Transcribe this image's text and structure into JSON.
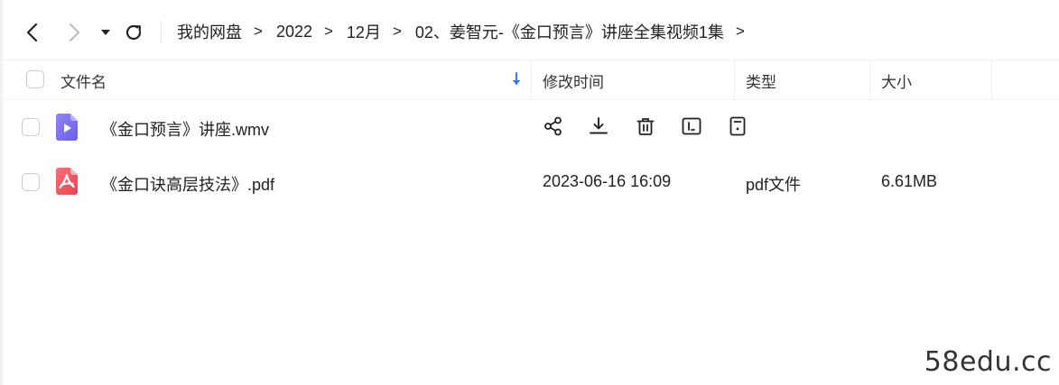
{
  "toolbar": {
    "back_icon": "chevron-left-icon",
    "forward_icon": "chevron-right-icon",
    "dropdown_icon": "caret-down-icon",
    "refresh_icon": "refresh-icon"
  },
  "breadcrumb": {
    "items": [
      "我的网盘",
      "2022",
      "12月",
      "02、姜智元-《金口预言》讲座全集视频1集"
    ],
    "separator": ">"
  },
  "table": {
    "columns": {
      "name": "文件名",
      "modified": "修改时间",
      "type": "类型",
      "size": "大小"
    },
    "rows": [
      {
        "name": "《金口预言》讲座.wmv",
        "icon": "video-file-icon",
        "modified": "",
        "type": "",
        "size": "",
        "hover_actions": [
          "share-icon",
          "download-icon",
          "delete-icon",
          "rename-icon",
          "more-icon"
        ]
      },
      {
        "name": "《金口诀高层技法》.pdf",
        "icon": "pdf-file-icon",
        "modified": "2023-06-16 16:09",
        "type": "pdf文件",
        "size": "6.61MB"
      }
    ]
  },
  "colors": {
    "video_icon": "#7b6ff0",
    "pdf_icon": "#f0515e",
    "sort_arrow": "#2f7df6",
    "border": "#eceef1"
  },
  "watermark": "58edu.cc"
}
